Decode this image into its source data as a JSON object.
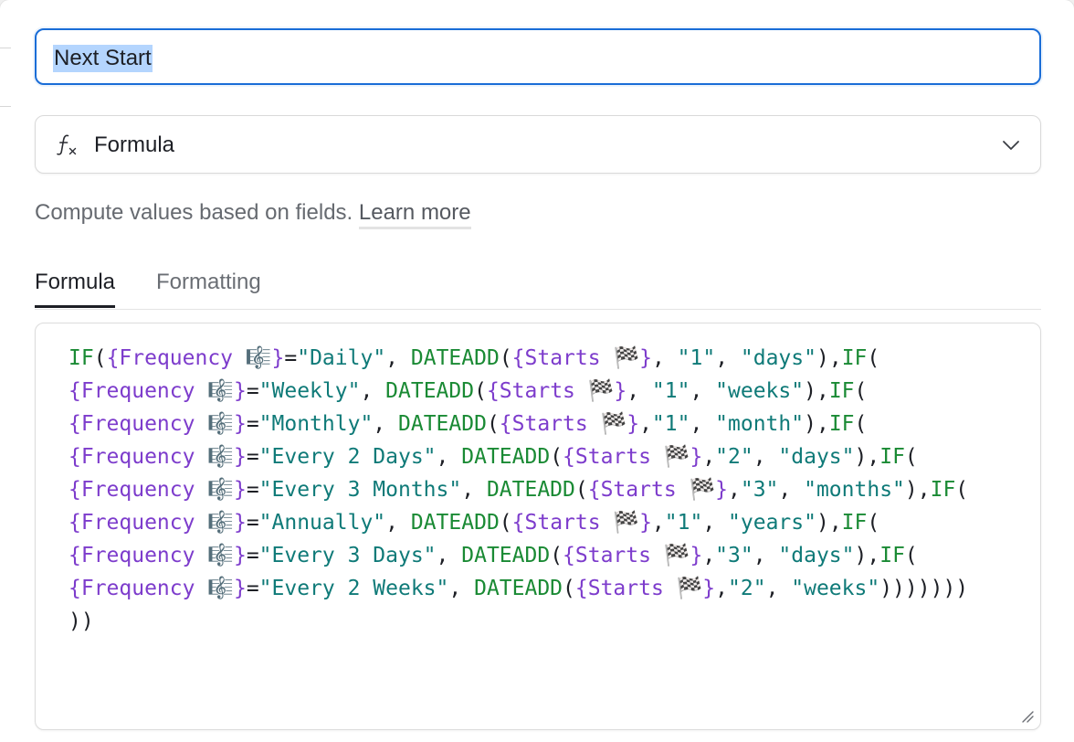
{
  "field_name": {
    "value": "Next Start"
  },
  "field_type": {
    "icon": "formula-fx-icon",
    "label": "Formula"
  },
  "help": {
    "text": "Compute values based on fields.",
    "link": "Learn more"
  },
  "tabs": [
    {
      "label": "Formula",
      "active": true
    },
    {
      "label": "Formatting",
      "active": false
    }
  ],
  "formula": {
    "lines": [
      "IF({Frequency 🎼}=\"Daily\", DATEADD({Starts 🏁}, \"1\", \"days\"),IF(",
      "{Frequency 🎼}=\"Weekly\", DATEADD({Starts 🏁}, \"1\", \"weeks\"),IF(",
      "{Frequency 🎼}=\"Monthly\", DATEADD({Starts 🏁},\"1\", \"month\"),IF(",
      "{Frequency 🎼}=\"Every 2 Days\", DATEADD({Starts 🏁},\"2\", \"days\"),IF(",
      "{Frequency 🎼}=\"Every 3 Months\", DATEADD({Starts 🏁},\"3\", \"months\"),IF(",
      "{Frequency 🎼}=\"Annually\", DATEADD({Starts 🏁},\"1\", \"years\"),IF(",
      "{Frequency 🎼}=\"Every 3 Days\", DATEADD({Starts 🏁},\"3\", \"days\"),IF(",
      "{Frequency 🎼}=\"Every 2 Weeks\", DATEADD({Starts 🏁},\"2\", \"weeks\")))))))",
      "))"
    ]
  },
  "colors": {
    "focus_border": "#1a6dd7",
    "selection": "#b4d5fe",
    "function": "#1a8a34",
    "field_ref": "#7d3ccc",
    "string": "#0f7a78"
  }
}
